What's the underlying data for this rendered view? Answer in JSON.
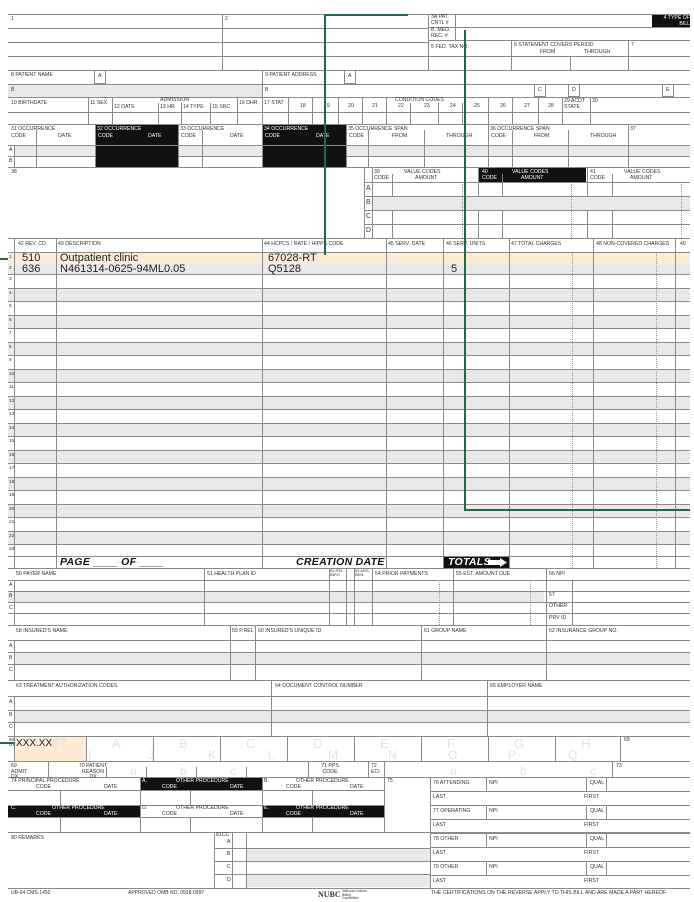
{
  "header": {
    "f1": "1",
    "f2": "2",
    "f3a": "3a PAT. CNTL #",
    "f3b": "b. MED. REC. #",
    "f4": "4 TYPE OF BILL",
    "f5": "5 FED. TAX NO.",
    "f6": "6 STATEMENT COVERS PERIOD",
    "f6from": "FROM",
    "f6thru": "THROUGH",
    "f7": "7"
  },
  "patient": {
    "f8": "8 PATIENT NAME",
    "f8a": "a",
    "f8b": "b",
    "f9": "9 PATIENT ADDRESS",
    "f9a": "a",
    "f9b": "b",
    "f9c": "c",
    "f9d": "d",
    "f9e": "e"
  },
  "row10": {
    "f10": "10 BIRTHDATE",
    "f11": "11 SEX",
    "admission": "ADMISSION",
    "f12": "12 DATE",
    "f13": "13 HR",
    "f14": "14 TYPE",
    "f15": "15 SRC",
    "f16": "16 DHR",
    "f17": "17 STAT",
    "cond": "CONDITION CODES",
    "c18": "18",
    "c19": "19",
    "c20": "20",
    "c21": "21",
    "c22": "22",
    "c23": "23",
    "c24": "24",
    "c25": "25",
    "c26": "26",
    "c27": "27",
    "c28": "28",
    "f29": "29 ACDT STATE",
    "f30": "30"
  },
  "occ": {
    "f31": "31 OCCURRENCE",
    "f32": "32 OCCURRENCE",
    "f33": "33 OCCURRENCE",
    "f34": "34 OCCURRENCE",
    "code": "CODE",
    "date": "DATE",
    "f35": "35 OCCURRENCE SPAN",
    "f36": "36 OCCURRENCE SPAN",
    "from": "FROM",
    "through": "THROUGH",
    "f37": "37",
    "a": "a",
    "b": "b"
  },
  "values": {
    "f38": "38",
    "f39": "39",
    "f40": "40",
    "f41": "41",
    "vc": "VALUE CODES",
    "code": "CODE",
    "amount": "AMOUNT",
    "a": "a",
    "b": "b",
    "c": "c",
    "d": "d"
  },
  "lines": {
    "h42": "42 REV. CD.",
    "h43": "43 DESCRIPTION",
    "h44": "44 HCPCS / RATE / HIPPS CODE",
    "h45": "45 SERV. DATE",
    "h46": "46 SERV. UNITS",
    "h47": "47 TOTAL CHARGES",
    "h48": "48 NON-COVERED CHARGES",
    "h49": "49",
    "rows": [
      {
        "n": "1",
        "rev": "510",
        "desc": "Outpatient clinic",
        "hcpcs": "67028-RT",
        "units": ""
      },
      {
        "n": "2",
        "rev": "636",
        "desc": "N461314-0625-94ML0.05",
        "hcpcs": "Q5128",
        "units": "5"
      }
    ],
    "nums": [
      "3",
      "4",
      "5",
      "6",
      "7",
      "8",
      "9",
      "10",
      "11",
      "12",
      "13",
      "14",
      "15",
      "16",
      "17",
      "18",
      "19",
      "20",
      "21",
      "22",
      "23"
    ],
    "page": "PAGE ____ OF ____",
    "creation": "CREATION DATE",
    "totals": "TOTALS"
  },
  "payer": {
    "f50": "50 PAYER NAME",
    "f51": "51 HEALTH PLAN ID",
    "f52": "52 REL. INFO",
    "f53": "53 ASG. BEN.",
    "f54": "54 PRIOR PAYMENTS",
    "f55": "55 EST. AMOUNT DUE",
    "f56": "56 NPI",
    "f57": "57",
    "other": "OTHER",
    "prvid": "PRV ID",
    "a": "A",
    "b": "B",
    "c": "C"
  },
  "insured": {
    "f58": "58 INSURED'S NAME",
    "f59": "59 P.REL",
    "f60": "60 INSURED'S UNIQUE ID",
    "f61": "61 GROUP NAME",
    "f62": "62 INSURANCE GROUP NO."
  },
  "auth": {
    "f63": "63 TREATMENT AUTHORIZATION CODES",
    "f64": "64 DOCUMENT CONTROL NUMBER",
    "f65": "65 EMPLOYER NAME"
  },
  "dx": {
    "f66": "66 DX",
    "value": "XXX.XX",
    "f67": "67",
    "f68": "68",
    "letters": [
      "A",
      "B",
      "C",
      "D",
      "E",
      "F",
      "G",
      "H"
    ],
    "letters2": [
      "I",
      "J",
      "K",
      "L",
      "M",
      "N",
      "O",
      "P",
      "Q"
    ],
    "f69": "69 ADMIT DX",
    "f70": "70 PATIENT REASON DX",
    "f71": "71 PPS CODE",
    "f72": "72 ECI",
    "f73": "73",
    "sub": [
      "a",
      "b",
      "c"
    ]
  },
  "procs": {
    "f74": "74 PRINCIPAL PROCEDURE",
    "other": "OTHER PROCEDURE",
    "code": "CODE",
    "date": "DATE",
    "a": "a.",
    "b": "b.",
    "c": "c.",
    "d": "d.",
    "e": "e.",
    "f75": "75"
  },
  "physicians": {
    "f76": "76 ATTENDING",
    "f77": "77 OPERATING",
    "f78": "78 OTHER",
    "f79": "79 OTHER",
    "npi": "NPI",
    "qual": "QUAL",
    "last": "LAST",
    "first": "FIRST"
  },
  "remarks": {
    "f80": "80 REMARKS",
    "f81": "81CC",
    "a": "a",
    "b": "b",
    "c": "c",
    "d": "d"
  },
  "footer": {
    "form": "UB-04 CMS-1450",
    "omb": "APPROVED OMB NO. 0938-0997",
    "nubc": "NUBC",
    "nubc_sub": "National Uniform Billing Committee",
    "cert": "THE CERTIFICATIONS ON THE REVERSE APPLY TO THIS BILL AND ARE MADE A PART HEREOF."
  }
}
